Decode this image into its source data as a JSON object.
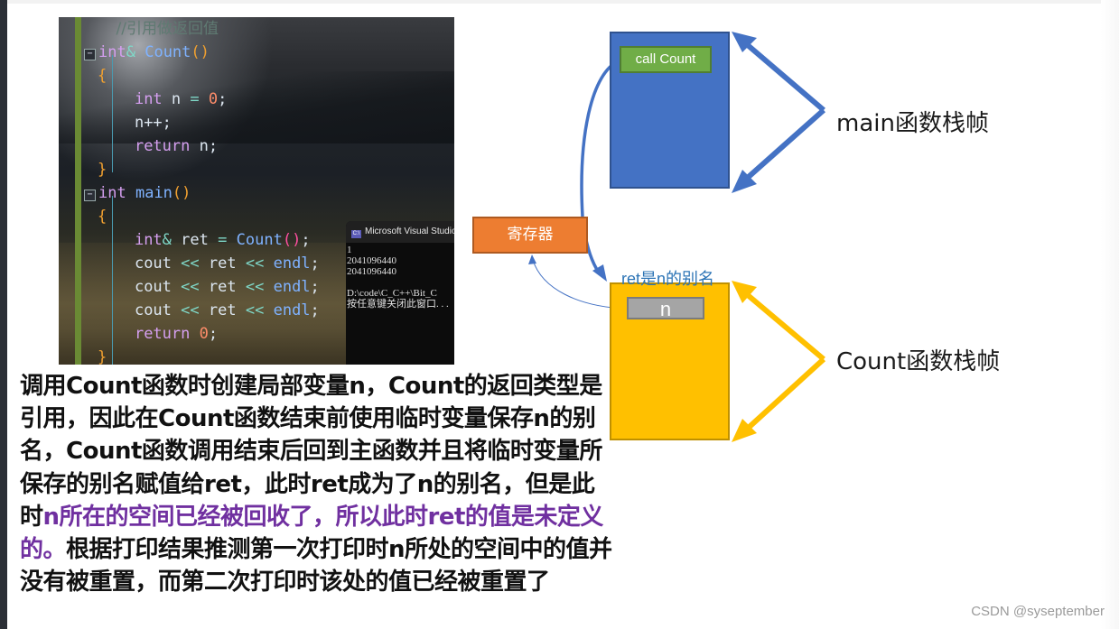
{
  "code_screenshot": {
    "lines": [
      {
        "type": "comment",
        "text": "//引用做返回值"
      },
      {
        "type": "sig",
        "kw": "int",
        "amp": "&",
        "name": "Count",
        "parens": "()"
      },
      {
        "type": "brace",
        "text": "{"
      },
      {
        "type": "decl",
        "kw": "int",
        "id": "n",
        "op": "=",
        "num": "0",
        "end": ";"
      },
      {
        "type": "stmt",
        "text": "n++;"
      },
      {
        "type": "ret",
        "kw": "return",
        "id": "n",
        "end": ";"
      },
      {
        "type": "brace",
        "text": "}"
      },
      {
        "type": "sig2",
        "kw": "int",
        "name": "main",
        "parens": "()"
      },
      {
        "type": "brace",
        "text": "{"
      },
      {
        "type": "decl_ref",
        "kw": "int",
        "amp": "&",
        "id": "ret",
        "op": "=",
        "fn": "Count",
        "parens": "()",
        "end": ";"
      },
      {
        "type": "cout",
        "a": "cout",
        "op": "<<",
        "id": "ret",
        "b": "endl",
        "end": ";"
      },
      {
        "type": "cout",
        "a": "cout",
        "op": "<<",
        "id": "ret",
        "b": "endl",
        "end": ";"
      },
      {
        "type": "cout",
        "a": "cout",
        "op": "<<",
        "id": "ret",
        "b": "endl",
        "end": ";"
      },
      {
        "type": "ret0",
        "kw": "return",
        "num": "0",
        "end": ";"
      },
      {
        "type": "brace",
        "text": "}"
      }
    ],
    "console": {
      "icon": "C:\\",
      "title": "Microsoft Visual Studio",
      "output": [
        "1",
        "2041096440",
        "2041096440",
        "",
        "D:\\code\\C_C++\\Bit_C",
        "按任意键关闭此窗口. . ."
      ]
    }
  },
  "diagram": {
    "main_frame_label": "main函数栈帧",
    "call_box_label": "call Count",
    "register_label": "寄存器",
    "alias_label": "ret是n的别名",
    "n_box_label": "n",
    "count_frame_label": "Count函数栈帧",
    "colors": {
      "main_frame": "#4472c4",
      "call_box": "#70ad47",
      "register": "#ed7d31",
      "count_frame": "#ffc000",
      "n_box": "#a5a5a5",
      "alias_text": "#2e75b6",
      "highlight_text": "#7030a0"
    }
  },
  "explanation": {
    "part1": "调用Count函数时创建局部变量n，Count的返回类型是引用，因此在Count函数结束前使用临时变量保存n的别名，Count函数调用结束后回到主函数并且将临时变量所保存的别名赋值给ret，此时ret成为了n的别名，但是此时",
    "highlight": "n所在的空间已经被回收了，所以此时ret的值是未定义的。",
    "part2": "根据打印结果推测第一次打印时n所处的空间中的值并没有被重置，而第二次打印时该处的值已经被重置了"
  },
  "watermark": "CSDN @syseptember"
}
